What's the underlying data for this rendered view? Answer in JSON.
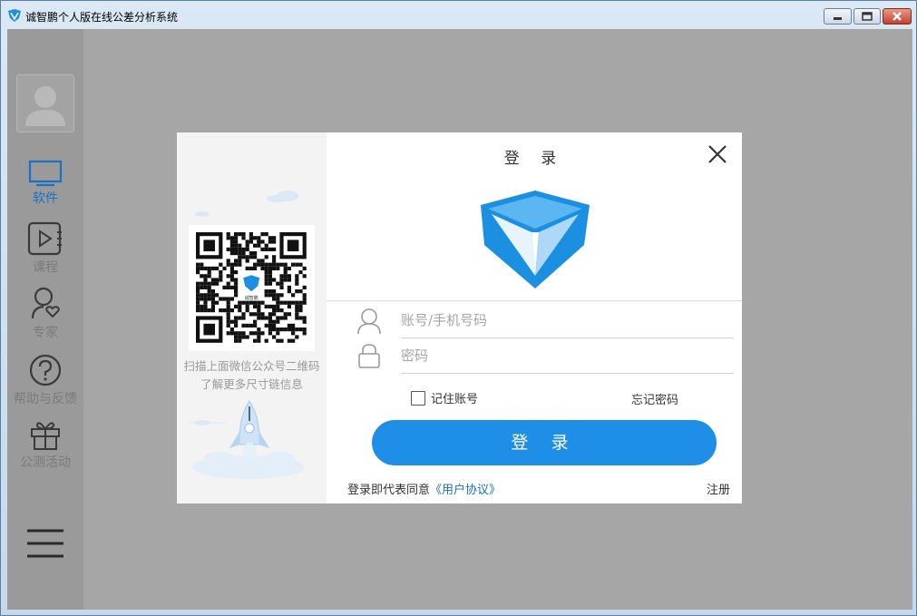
{
  "window": {
    "title": "诚智鹏个人版在线公差分析系统"
  },
  "sidebar": {
    "items": [
      {
        "label": "软件",
        "icon": "monitor-icon",
        "active": true
      },
      {
        "label": "课程",
        "icon": "video-play-icon",
        "active": false
      },
      {
        "label": "专家",
        "icon": "person-heart-icon",
        "active": false
      },
      {
        "label": "帮助与反馈",
        "icon": "help-circle-icon",
        "active": false
      },
      {
        "label": "公测活动",
        "icon": "gift-icon",
        "active": false
      }
    ]
  },
  "qr_panel": {
    "caption_line1": "扫描上面微信公众号二维码",
    "caption_line2": "了解更多尺寸链信息",
    "qr_center_text": "诚智鹏"
  },
  "login": {
    "title": "登 录",
    "account_placeholder": "账号/手机号码",
    "password_placeholder": "密码",
    "remember_label": "记住账号",
    "forgot_label": "忘记密码",
    "submit_label": "登 录",
    "agree_text": "登录即代表同意",
    "agreement_link": "《用户协议》",
    "register_label": "注册"
  },
  "colors": {
    "accent": "#1f8ee6",
    "logo_blue": "#1b8fe0",
    "active_nav": "#1a72c4"
  }
}
